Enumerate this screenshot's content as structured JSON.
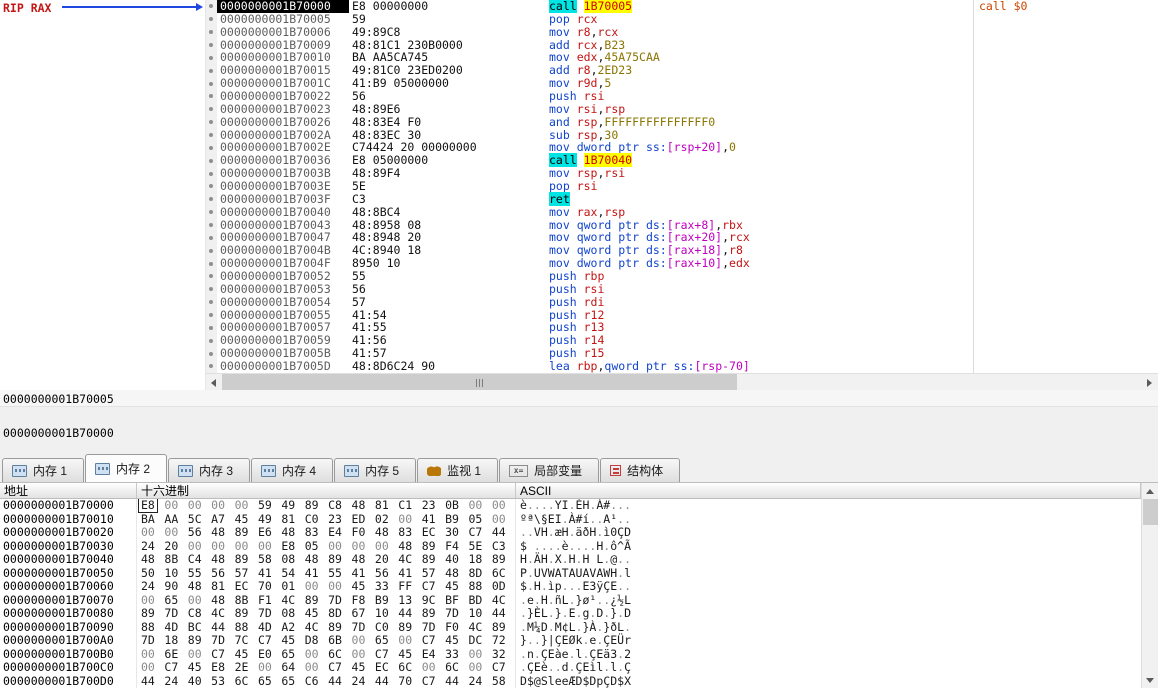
{
  "colors": {
    "mnemonic": "#1144cc",
    "register": "#c41414",
    "number": "#8a7500",
    "memory_operand": "#c000c0",
    "call_ret_bg": "#00e4e4",
    "branch_target_fg": "#d00000",
    "branch_target_bg": "#ffff00",
    "comment": "#cc4400",
    "cip_address_bg": "#000000",
    "rip_label": "#c41414",
    "arrow": "#2047e0"
  },
  "registers_pane": {
    "rip_label": "RIP RAX"
  },
  "status": {
    "line1": "0000000001B70005",
    "line2": "0000000001B70000"
  },
  "disassembly": {
    "rows": [
      {
        "addr": "0000000001B70000",
        "bytes": "E8 00000000",
        "ops": [
          [
            "k",
            "call"
          ],
          [
            "t",
            " "
          ],
          [
            "a",
            "1B70005"
          ]
        ],
        "comment": "call $0",
        "current": true
      },
      {
        "addr": "0000000001B70005",
        "bytes": "59",
        "ops": [
          [
            "m",
            "pop "
          ],
          [
            "r",
            "rcx"
          ]
        ]
      },
      {
        "addr": "0000000001B70006",
        "bytes": "49:89C8",
        "ops": [
          [
            "m",
            "mov "
          ],
          [
            "r",
            "r8"
          ],
          [
            "t",
            ","
          ],
          [
            "r",
            "rcx"
          ]
        ]
      },
      {
        "addr": "0000000001B70009",
        "bytes": "48:81C1 230B0000",
        "ops": [
          [
            "m",
            "add "
          ],
          [
            "r",
            "rcx"
          ],
          [
            "t",
            ","
          ],
          [
            "n",
            "B23"
          ]
        ]
      },
      {
        "addr": "0000000001B70010",
        "bytes": "BA AA5CA745",
        "ops": [
          [
            "m",
            "mov "
          ],
          [
            "r",
            "edx"
          ],
          [
            "t",
            ","
          ],
          [
            "n",
            "45A75CAA"
          ]
        ]
      },
      {
        "addr": "0000000001B70015",
        "bytes": "49:81C0 23ED0200",
        "ops": [
          [
            "m",
            "add "
          ],
          [
            "r",
            "r8"
          ],
          [
            "t",
            ","
          ],
          [
            "n",
            "2ED23"
          ]
        ]
      },
      {
        "addr": "0000000001B7001C",
        "bytes": "41:B9 05000000",
        "ops": [
          [
            "m",
            "mov "
          ],
          [
            "r",
            "r9d"
          ],
          [
            "t",
            ","
          ],
          [
            "n",
            "5"
          ]
        ]
      },
      {
        "addr": "0000000001B70022",
        "bytes": "56",
        "ops": [
          [
            "m",
            "push "
          ],
          [
            "r",
            "rsi"
          ]
        ]
      },
      {
        "addr": "0000000001B70023",
        "bytes": "48:89E6",
        "ops": [
          [
            "m",
            "mov "
          ],
          [
            "r",
            "rsi"
          ],
          [
            "t",
            ","
          ],
          [
            "r",
            "rsp"
          ]
        ]
      },
      {
        "addr": "0000000001B70026",
        "bytes": "48:83E4 F0",
        "ops": [
          [
            "m",
            "and "
          ],
          [
            "r",
            "rsp"
          ],
          [
            "t",
            ","
          ],
          [
            "n",
            "FFFFFFFFFFFFFFF0"
          ]
        ]
      },
      {
        "addr": "0000000001B7002A",
        "bytes": "48:83EC 30",
        "ops": [
          [
            "m",
            "sub "
          ],
          [
            "r",
            "rsp"
          ],
          [
            "t",
            ","
          ],
          [
            "n",
            "30"
          ]
        ]
      },
      {
        "addr": "0000000001B7002E",
        "bytes": "C74424 20 00000000",
        "ops": [
          [
            "m",
            "mov "
          ],
          [
            "g",
            "dword ptr ss:"
          ],
          [
            "b",
            "[rsp+20]"
          ],
          [
            "t",
            ","
          ],
          [
            "n",
            "0"
          ]
        ]
      },
      {
        "addr": "0000000001B70036",
        "bytes": "E8 05000000",
        "ops": [
          [
            "k",
            "call"
          ],
          [
            "t",
            " "
          ],
          [
            "a",
            "1B70040"
          ]
        ]
      },
      {
        "addr": "0000000001B7003B",
        "bytes": "48:89F4",
        "ops": [
          [
            "m",
            "mov "
          ],
          [
            "r",
            "rsp"
          ],
          [
            "t",
            ","
          ],
          [
            "r",
            "rsi"
          ]
        ]
      },
      {
        "addr": "0000000001B7003E",
        "bytes": "5E",
        "ops": [
          [
            "m",
            "pop "
          ],
          [
            "r",
            "rsi"
          ]
        ]
      },
      {
        "addr": "0000000001B7003F",
        "bytes": "C3",
        "ops": [
          [
            "k",
            "ret"
          ]
        ]
      },
      {
        "addr": "0000000001B70040",
        "bytes": "48:8BC4",
        "ops": [
          [
            "m",
            "mov "
          ],
          [
            "r",
            "rax"
          ],
          [
            "t",
            ","
          ],
          [
            "r",
            "rsp"
          ]
        ]
      },
      {
        "addr": "0000000001B70043",
        "bytes": "48:8958 08",
        "ops": [
          [
            "m",
            "mov "
          ],
          [
            "g",
            "qword ptr ds:"
          ],
          [
            "b",
            "[rax+8]"
          ],
          [
            "t",
            ","
          ],
          [
            "r",
            "rbx"
          ]
        ]
      },
      {
        "addr": "0000000001B70047",
        "bytes": "48:8948 20",
        "ops": [
          [
            "m",
            "mov "
          ],
          [
            "g",
            "qword ptr ds:"
          ],
          [
            "b",
            "[rax+20]"
          ],
          [
            "t",
            ","
          ],
          [
            "r",
            "rcx"
          ]
        ]
      },
      {
        "addr": "0000000001B7004B",
        "bytes": "4C:8940 18",
        "ops": [
          [
            "m",
            "mov "
          ],
          [
            "g",
            "qword ptr ds:"
          ],
          [
            "b",
            "[rax+18]"
          ],
          [
            "t",
            ","
          ],
          [
            "r",
            "r8"
          ]
        ]
      },
      {
        "addr": "0000000001B7004F",
        "bytes": "8950 10",
        "ops": [
          [
            "m",
            "mov "
          ],
          [
            "g",
            "dword ptr ds:"
          ],
          [
            "b",
            "[rax+10]"
          ],
          [
            "t",
            ","
          ],
          [
            "r",
            "edx"
          ]
        ]
      },
      {
        "addr": "0000000001B70052",
        "bytes": "55",
        "ops": [
          [
            "m",
            "push "
          ],
          [
            "r",
            "rbp"
          ]
        ]
      },
      {
        "addr": "0000000001B70053",
        "bytes": "56",
        "ops": [
          [
            "m",
            "push "
          ],
          [
            "r",
            "rsi"
          ]
        ]
      },
      {
        "addr": "0000000001B70054",
        "bytes": "57",
        "ops": [
          [
            "m",
            "push "
          ],
          [
            "r",
            "rdi"
          ]
        ]
      },
      {
        "addr": "0000000001B70055",
        "bytes": "41:54",
        "ops": [
          [
            "m",
            "push "
          ],
          [
            "r",
            "r12"
          ]
        ]
      },
      {
        "addr": "0000000001B70057",
        "bytes": "41:55",
        "ops": [
          [
            "m",
            "push "
          ],
          [
            "r",
            "r13"
          ]
        ]
      },
      {
        "addr": "0000000001B70059",
        "bytes": "41:56",
        "ops": [
          [
            "m",
            "push "
          ],
          [
            "r",
            "r14"
          ]
        ]
      },
      {
        "addr": "0000000001B7005B",
        "bytes": "41:57",
        "ops": [
          [
            "m",
            "push "
          ],
          [
            "r",
            "r15"
          ]
        ]
      },
      {
        "addr": "0000000001B7005D",
        "bytes": "48:8D6C24 90",
        "ops": [
          [
            "m",
            "lea "
          ],
          [
            "r",
            "rbp"
          ],
          [
            "t",
            ","
          ],
          [
            "g",
            "qword ptr ss:"
          ],
          [
            "b",
            "[rsp-70]"
          ]
        ]
      }
    ]
  },
  "tabs": [
    {
      "id": "memory-1",
      "label": "内存 1",
      "icon": "memory",
      "active": false
    },
    {
      "id": "memory-2",
      "label": "内存 2",
      "icon": "memory",
      "active": true
    },
    {
      "id": "memory-3",
      "label": "内存 3",
      "icon": "memory",
      "active": false
    },
    {
      "id": "memory-4",
      "label": "内存 4",
      "icon": "memory",
      "active": false
    },
    {
      "id": "memory-5",
      "label": "内存 5",
      "icon": "memory",
      "active": false
    },
    {
      "id": "watch-1",
      "label": "监视 1",
      "icon": "watch",
      "active": false
    },
    {
      "id": "locals",
      "label": "局部变量",
      "icon": "locals",
      "active": false
    },
    {
      "id": "struct",
      "label": "结构体",
      "icon": "struct",
      "active": false
    }
  ],
  "dump": {
    "headers": [
      "地址",
      "十六进制",
      "ASCII"
    ],
    "selected_byte": {
      "row": 0,
      "col": 0
    },
    "rows": [
      {
        "addr": "0000000001B70000",
        "bytes": [
          "E8",
          "00",
          "00",
          "00",
          "00",
          "59",
          "49",
          "89",
          "C8",
          "48",
          "81",
          "C1",
          "23",
          "0B",
          "00",
          "00"
        ],
        "ascii": "è....YI.ÈH.Á#..."
      },
      {
        "addr": "0000000001B70010",
        "bytes": [
          "BA",
          "AA",
          "5C",
          "A7",
          "45",
          "49",
          "81",
          "C0",
          "23",
          "ED",
          "02",
          "00",
          "41",
          "B9",
          "05",
          "00"
        ],
        "ascii": "ºª\\§EI.À#í..A¹.."
      },
      {
        "addr": "0000000001B70020",
        "bytes": [
          "00",
          "00",
          "56",
          "48",
          "89",
          "E6",
          "48",
          "83",
          "E4",
          "F0",
          "48",
          "83",
          "EC",
          "30",
          "C7",
          "44"
        ],
        "ascii": "..VH.æH.äðH.ì0ÇD"
      },
      {
        "addr": "0000000001B70030",
        "bytes": [
          "24",
          "20",
          "00",
          "00",
          "00",
          "00",
          "E8",
          "05",
          "00",
          "00",
          "00",
          "48",
          "89",
          "F4",
          "5E",
          "C3"
        ],
        "ascii": "$ ....è....H.ô^Ã"
      },
      {
        "addr": "0000000001B70040",
        "bytes": [
          "48",
          "8B",
          "C4",
          "48",
          "89",
          "58",
          "08",
          "48",
          "89",
          "48",
          "20",
          "4C",
          "89",
          "40",
          "18",
          "89"
        ],
        "ascii": "H.ÄH.X.H.H L.@.."
      },
      {
        "addr": "0000000001B70050",
        "bytes": [
          "50",
          "10",
          "55",
          "56",
          "57",
          "41",
          "54",
          "41",
          "55",
          "41",
          "56",
          "41",
          "57",
          "48",
          "8D",
          "6C"
        ],
        "ascii": "P.UVWATAUAVAWH.l"
      },
      {
        "addr": "0000000001B70060",
        "bytes": [
          "24",
          "90",
          "48",
          "81",
          "EC",
          "70",
          "01",
          "00",
          "00",
          "45",
          "33",
          "FF",
          "C7",
          "45",
          "88",
          "0D"
        ],
        "ascii": "$.H.ìp...E3ÿÇE.."
      },
      {
        "addr": "0000000001B70070",
        "bytes": [
          "00",
          "65",
          "00",
          "48",
          "8B",
          "F1",
          "4C",
          "89",
          "7D",
          "F8",
          "B9",
          "13",
          "9C",
          "BF",
          "BD",
          "4C"
        ],
        "ascii": ".e.H.ñL.}ø¹..¿½L"
      },
      {
        "addr": "0000000001B70080",
        "bytes": [
          "89",
          "7D",
          "C8",
          "4C",
          "89",
          "7D",
          "08",
          "45",
          "8D",
          "67",
          "10",
          "44",
          "89",
          "7D",
          "10",
          "44"
        ],
        "ascii": ".}ÈL.}.E.g.D.}.D"
      },
      {
        "addr": "0000000001B70090",
        "bytes": [
          "88",
          "4D",
          "BC",
          "44",
          "88",
          "4D",
          "A2",
          "4C",
          "89",
          "7D",
          "C0",
          "89",
          "7D",
          "F0",
          "4C",
          "89"
        ],
        "ascii": ".M¼D.M¢L.}À.}ðL."
      },
      {
        "addr": "0000000001B700A0",
        "bytes": [
          "7D",
          "18",
          "89",
          "7D",
          "7C",
          "C7",
          "45",
          "D8",
          "6B",
          "00",
          "65",
          "00",
          "C7",
          "45",
          "DC",
          "72"
        ],
        "ascii": "}..}|ÇEØk.e.ÇEÜr"
      },
      {
        "addr": "0000000001B700B0",
        "bytes": [
          "00",
          "6E",
          "00",
          "C7",
          "45",
          "E0",
          "65",
          "00",
          "6C",
          "00",
          "C7",
          "45",
          "E4",
          "33",
          "00",
          "32"
        ],
        "ascii": ".n.ÇEàe.l.ÇEä3.2"
      },
      {
        "addr": "0000000001B700C0",
        "bytes": [
          "00",
          "C7",
          "45",
          "E8",
          "2E",
          "00",
          "64",
          "00",
          "C7",
          "45",
          "EC",
          "6C",
          "00",
          "6C",
          "00",
          "C7"
        ],
        "ascii": ".ÇEè..d.ÇEìl.l.Ç"
      },
      {
        "addr": "0000000001B700D0",
        "bytes": [
          "44",
          "24",
          "40",
          "53",
          "6C",
          "65",
          "65",
          "C6",
          "44",
          "24",
          "44",
          "70",
          "C7",
          "44",
          "24",
          "58"
        ],
        "ascii": "D$@SleeÆD$DpÇD$X"
      }
    ]
  }
}
